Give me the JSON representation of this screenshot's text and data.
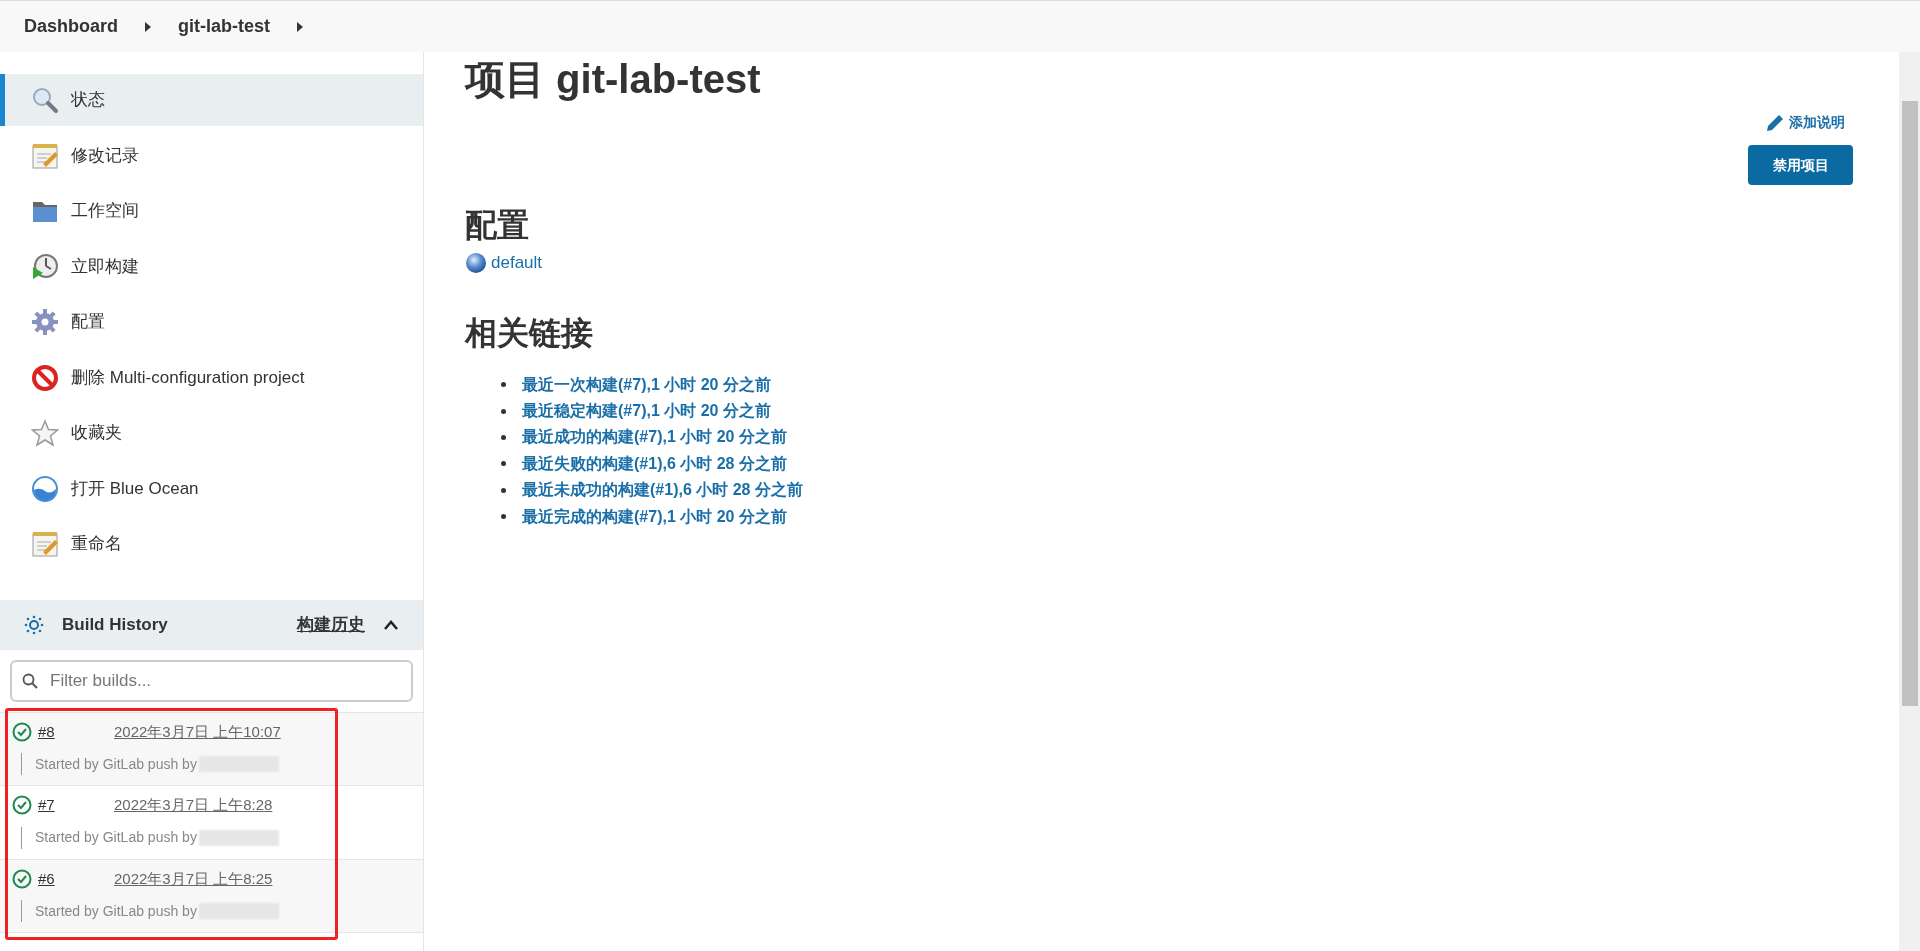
{
  "breadcrumb": [
    {
      "label": "Dashboard"
    },
    {
      "label": "git-lab-test"
    }
  ],
  "sidebar": {
    "items": [
      {
        "label": "状态",
        "selected": true
      },
      {
        "label": "修改记录",
        "selected": false
      },
      {
        "label": "工作空间",
        "selected": false
      },
      {
        "label": "立即构建",
        "selected": false
      },
      {
        "label": "配置",
        "selected": false
      },
      {
        "label": "删除 Multi-configuration project",
        "selected": false
      },
      {
        "label": "收藏夹",
        "selected": false
      },
      {
        "label": "打开 Blue Ocean",
        "selected": false
      },
      {
        "label": "重命名",
        "selected": false
      }
    ]
  },
  "build_history": {
    "title": "Build History",
    "link": "构建历史",
    "expanded": true,
    "filter": {
      "placeholder": "Filter builds..."
    },
    "builds": [
      {
        "number": "#8",
        "time": "2022年3月7日 上午10:07",
        "cause": "Started by GitLab push by"
      },
      {
        "number": "#7",
        "time": "2022年3月7日 上午8:28",
        "cause": "Started by GitLab push by"
      },
      {
        "number": "#6",
        "time": "2022年3月7日 上午8:25",
        "cause": "Started by GitLab push by"
      }
    ]
  },
  "main": {
    "title": "项目 git-lab-test",
    "add_description": "添加说明",
    "disable_button": "禁用项目",
    "config_heading": "配置",
    "configurations": [
      {
        "label": "default"
      }
    ],
    "links_heading": "相关链接",
    "links": [
      {
        "label": "最近一次构建(#7),1 小时 20 分之前"
      },
      {
        "label": "最近稳定构建(#7),1 小时 20 分之前"
      },
      {
        "label": "最近成功的构建(#7),1 小时 20 分之前"
      },
      {
        "label": "最近失败的构建(#1),6 小时 28 分之前"
      },
      {
        "label": "最近未成功的构建(#1),6 小时 28 分之前"
      },
      {
        "label": "最近完成的构建(#7),1 小时 20 分之前"
      }
    ]
  }
}
